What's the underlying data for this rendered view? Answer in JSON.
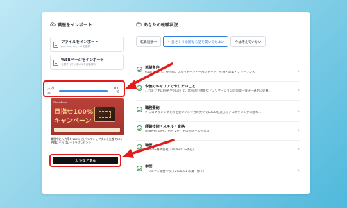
{
  "import": {
    "title": "職歴をインポート",
    "file_title": "ファイルをインポート",
    "file_sub": "pdf, doc, xls, md を選択",
    "web_title": "WEBページをインポート",
    "web_sub": "公開されているURLを自動解析"
  },
  "progress": {
    "label": "入力率",
    "percent_text": "100 %",
    "fraction": 1.0
  },
  "banner": {
    "brand": "Datadeco",
    "headline1": "目指せ100%",
    "headline2": "キャンペーン"
  },
  "share": {
    "description": "職歴中に入力率を100％にしてXでシェアすると先着で100名様にチョコレートをプレゼント！",
    "button_label": "シェアする",
    "button_icon": "x-icon"
  },
  "status": {
    "title": "あなたの転職状況",
    "tabs": [
      {
        "label": "転職活動中",
        "active": false
      },
      {
        "label": "良さそうな所なら話を聞いてもよい",
        "active": true
      },
      {
        "label": "今は考えていない",
        "active": false
      }
    ]
  },
  "items": [
    {
      "title": "希望条件",
      "detail": "650万円以上、東京都、フルリモート・一部リモート、社員・副業・フリーランス"
    },
    {
      "title": "今後のキャリアでやりたいこと",
      "detail": "これまで主にPHP や Ruby で、比較的小規模なアプリケーションの開発・保守・運用に従事…"
    },
    {
      "title": "職務要約",
      "detail": "# プログラミングとの出会いアメリカの大学でLOGOを通じてプログラミングに触れ…"
    },
    {
      "title": "経験技術・スキル・資格",
      "detail": "経験技術 19件、語学 2件、その他スキル入力済"
    },
    {
      "title": "職歴",
      "detail": "LAPRAS株式会社（2026/01〜現在）"
    },
    {
      "title": "学歴",
      "detail": "トリニティ総合学院（2026/01 卒業・修了）"
    }
  ],
  "colors": {
    "accent": "#2f7ee0",
    "highlight": "#e31b1b",
    "check": "#4c9b5d"
  }
}
